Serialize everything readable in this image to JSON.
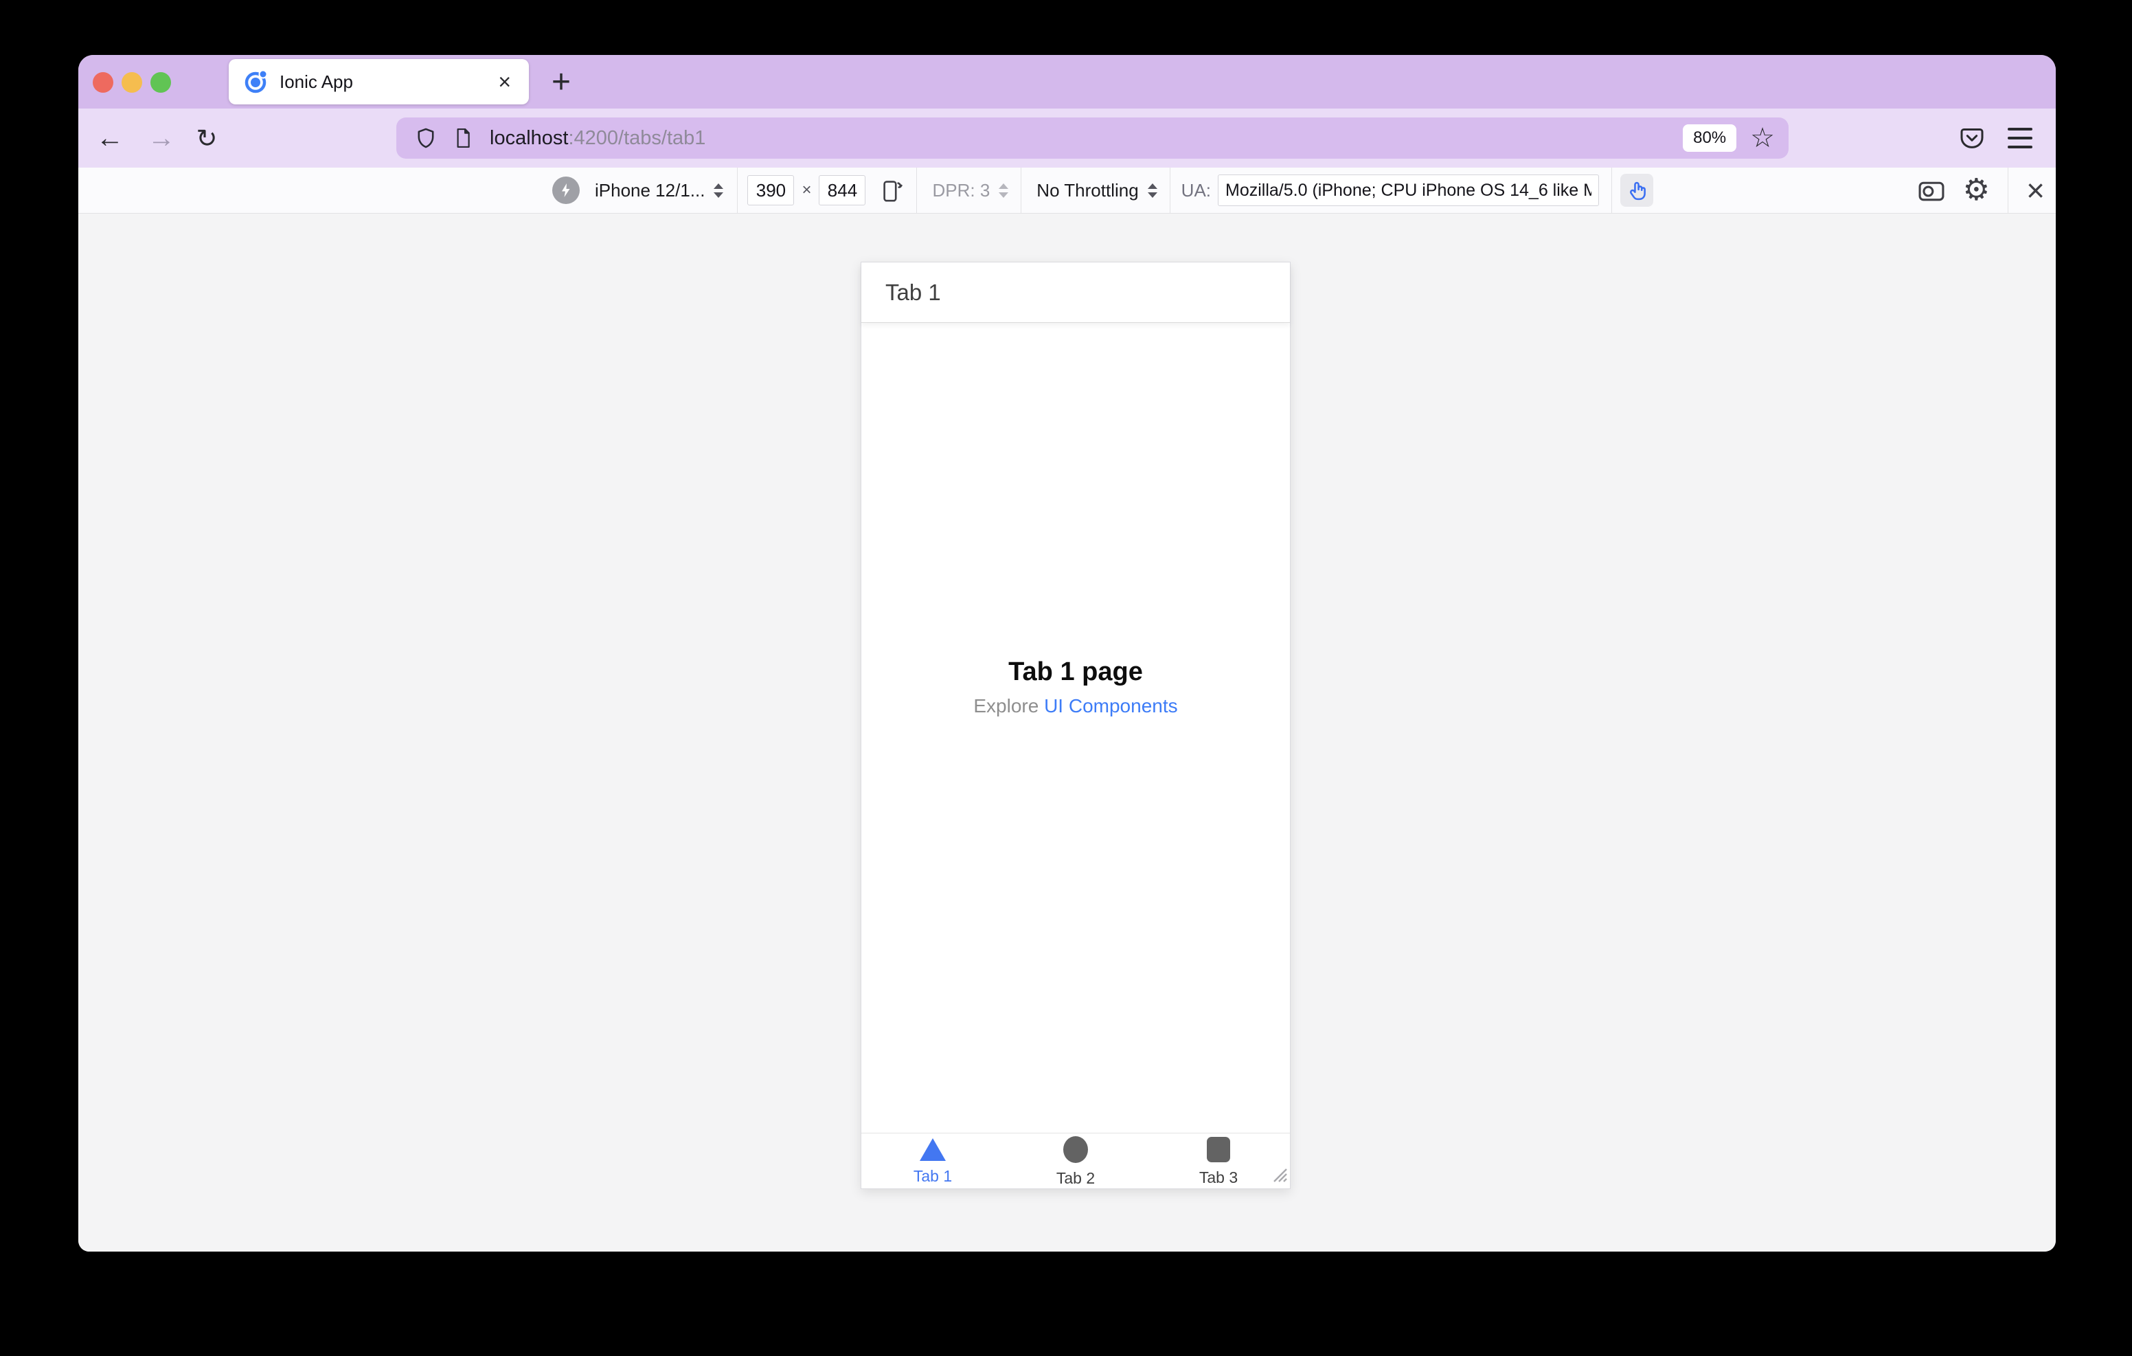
{
  "tab_strip": {
    "tab_title": "Ionic App"
  },
  "nav": {
    "url_host": "localhost",
    "url_path": ":4200/tabs/tab1",
    "zoom_badge": "80%"
  },
  "rdm": {
    "device": "iPhone 12/1...",
    "width": "390",
    "multiply": "×",
    "height": "844",
    "dpr": "DPR: 3",
    "throttling": "No Throttling",
    "ua_label": "UA:",
    "ua_value": "Mozilla/5.0 (iPhone; CPU iPhone OS 14_6 like M"
  },
  "phone": {
    "header_title": "Tab 1",
    "page_title": "Tab 1 page",
    "explore_prefix": "Explore ",
    "explore_link": "UI Components",
    "tabs": [
      {
        "label": "Tab 1",
        "icon": "triangle-icon",
        "active": true
      },
      {
        "label": "Tab 2",
        "icon": "circle-icon",
        "active": false
      },
      {
        "label": "Tab 3",
        "icon": "square-icon",
        "active": false
      }
    ]
  },
  "icons": {
    "back": "←",
    "forward": "→",
    "reload": "↻",
    "star": "☆",
    "gear": "⚙",
    "close": "×",
    "tab_close": "×",
    "new_tab": "+"
  },
  "colors": {
    "tab_strip_bg": "#d4b9ec",
    "toolbar_bg": "#eadcf7",
    "url_field_bg": "#d7bcee",
    "content_bg": "#f4f4f5",
    "accent_blue": "#3d7cf7",
    "ionic_blue": "#3e80f7",
    "tab_active_blue": "#4377f1",
    "tab_inactive_gray": "#636363",
    "traffic_red": "#ee6a5f",
    "traffic_yellow": "#f5bd4f",
    "traffic_green": "#61c454"
  }
}
